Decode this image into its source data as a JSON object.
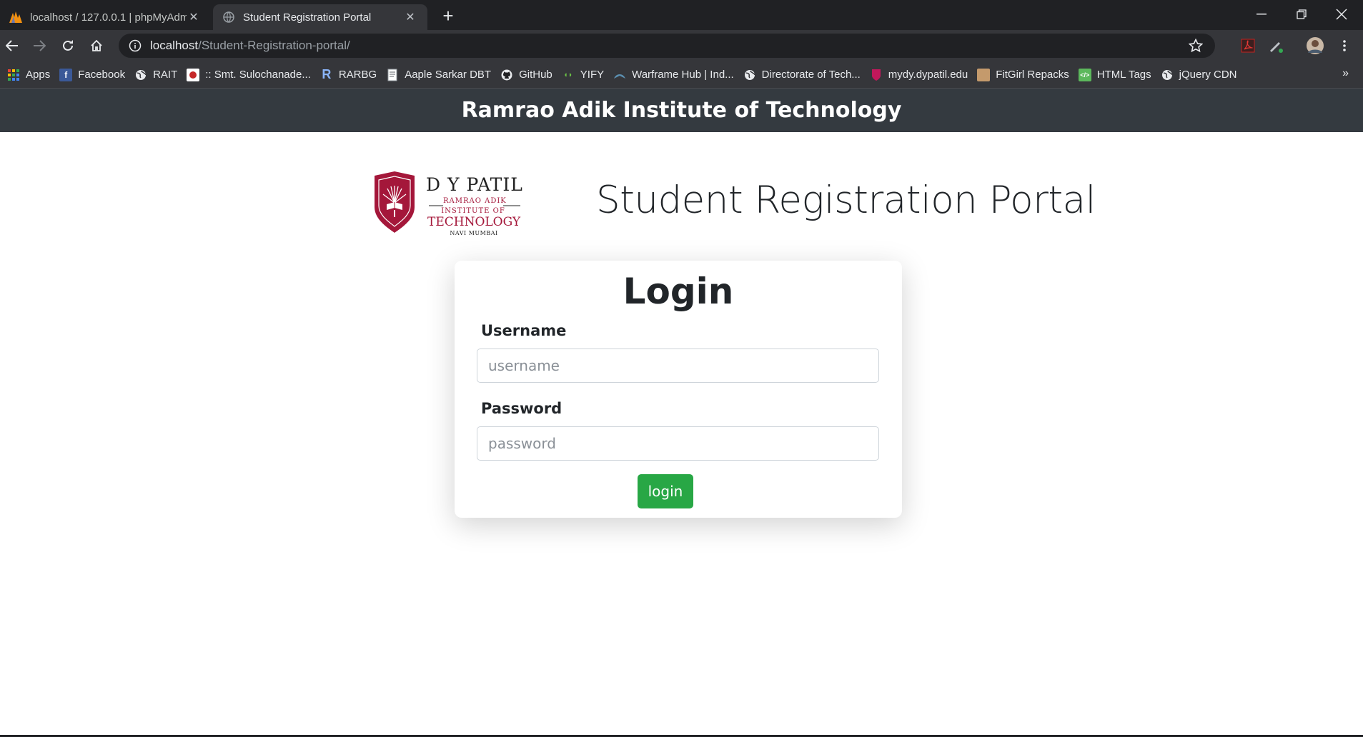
{
  "browser": {
    "tabs": [
      {
        "title": "localhost / 127.0.0.1 | phpMyAdmin",
        "icon": "phpmyadmin-icon"
      },
      {
        "title": "Student Registration Portal",
        "icon": "globe-icon"
      }
    ],
    "url_host": "localhost",
    "url_path": "/Student-Registration-portal/",
    "bookmarks": [
      {
        "label": "Apps",
        "icon": "apps-grid-icon"
      },
      {
        "label": "Facebook",
        "icon": "facebook-icon"
      },
      {
        "label": "RAIT",
        "icon": "globe-icon"
      },
      {
        "label": ":: Smt. Sulochanade...",
        "icon": "site-icon"
      },
      {
        "label": "RARBG",
        "icon": "rarbg-icon"
      },
      {
        "label": "Aaple Sarkar DBT",
        "icon": "document-icon"
      },
      {
        "label": "GitHub",
        "icon": "github-icon"
      },
      {
        "label": "YIFY",
        "icon": "yify-icon"
      },
      {
        "label": "Warframe Hub | Ind...",
        "icon": "warframe-icon"
      },
      {
        "label": "Directorate of Tech...",
        "icon": "globe-icon"
      },
      {
        "label": "mydy.dypatil.edu",
        "icon": "dypatil-icon"
      },
      {
        "label": "FitGirl Repacks",
        "icon": "fitgirl-icon"
      },
      {
        "label": "HTML Tags",
        "icon": "html-icon"
      },
      {
        "label": "jQuery CDN",
        "icon": "globe-icon"
      }
    ],
    "more_bookmarks": "»"
  },
  "page": {
    "navbar_title": "Ramrao Adik Institute of Technology",
    "logo": {
      "line1": "D Y PATIL",
      "line2": "RAMRAO ADIK",
      "line3": "INSTITUTE OF",
      "line4": "TECHNOLOGY",
      "line5": "NAVI MUMBAI"
    },
    "portal_title": "Student Registration Portal",
    "login": {
      "heading": "Login",
      "username_label": "Username",
      "username_placeholder": "username",
      "password_label": "Password",
      "password_placeholder": "password",
      "button_label": "login"
    }
  },
  "colors": {
    "navbar": "#343a40",
    "button": "#28a745",
    "logo_red": "#a4173a"
  }
}
